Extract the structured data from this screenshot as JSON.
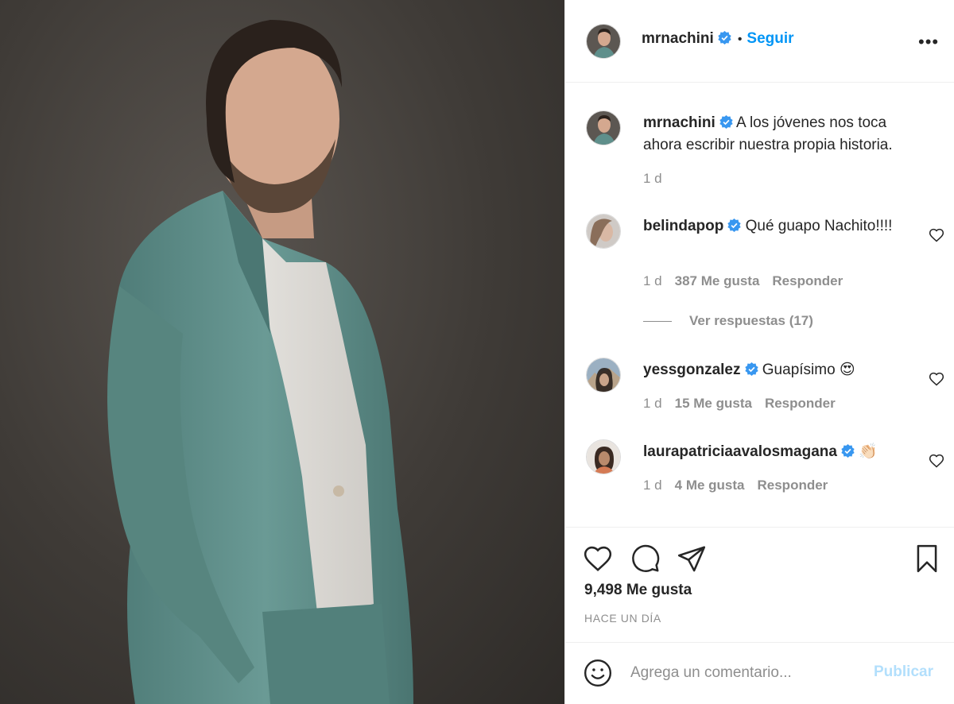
{
  "post": {
    "author": "mrnachini",
    "follow_label": "Seguir",
    "separator": "•",
    "more_label": "•••",
    "caption": "A los jóvenes nos toca ahora escribir nuestra propia historia.",
    "caption_time": "1 d",
    "likes": "9,498 Me gusta",
    "posted": "HACE UN DÍA"
  },
  "comments": [
    {
      "user": "belindapop",
      "text": "Qué guapo Nachito!!!!",
      "time": "1 d",
      "likes": "387 Me gusta",
      "reply": "Responder"
    },
    {
      "user": "yessgonzalez",
      "text": "Guapísimo 😍",
      "time": "1 d",
      "likes": "15 Me gusta",
      "reply": "Responder"
    },
    {
      "user": "laurapatriciaavalosmagana",
      "text": "👏🏻",
      "time": "1 d",
      "likes": "4 Me gusta",
      "reply": "Responder"
    }
  ],
  "view_replies": "Ver respuestas (17)",
  "compose": {
    "placeholder": "Agrega un comentario...",
    "publish_label": "Publicar"
  },
  "colors": {
    "accent": "#0095f6",
    "verified": "#3897f0",
    "suit": "#5f8f8b",
    "publish_disabled": "#b2dffc"
  }
}
